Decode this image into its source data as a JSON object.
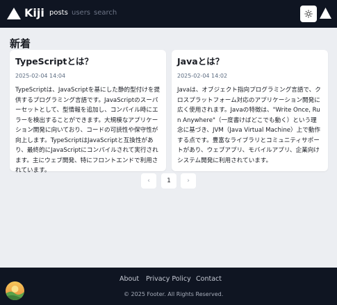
{
  "nav": {
    "brand": "Kiji",
    "links": [
      {
        "label": "posts"
      },
      {
        "label": "users"
      },
      {
        "label": "search"
      }
    ]
  },
  "main": {
    "section_title": "新着",
    "posts": [
      {
        "title": "TypeScriptとは？",
        "date": "2025-02-04 14:04",
        "body": "TypeScriptは、JavaScriptを基にした静的型付けを提供するプログラミング言語です。JavaScriptのスーパーセットとして、型情報を追加し、コンパイル時にエラーを検出することができます。大規模なアプリケーション開発に向いており、コードの可読性や保守性が向上します。TypeScriptはJavaScriptと互換性があり、最終的にJavaScriptにコンパイルされて実行されます。主にウェブ開発、特にフロントエンドで利用されています。"
      },
      {
        "title": "Javaとは？",
        "date": "2025-02-04 14:02",
        "body": "Javaは、オブジェクト指向プログラミング言語で、クロスプラットフォーム対応のアプリケーション開発に広く使用されます。Javaの特徴は、\"Write Once, Run Anywhere\"（一度書けばどこでも動く）という理念に基づき、JVM（Java Virtual Machine）上で動作する点です。豊富なライブラリとコミュニティサポートがあり、ウェブアプリ、モバイルアプリ、企業向けシステム開発に利用されています。"
      }
    ]
  },
  "pagination": {
    "prev": "‹",
    "current": "1",
    "next": "›"
  },
  "footer": {
    "links": [
      {
        "label": "About"
      },
      {
        "label": "Privacy Policy"
      },
      {
        "label": "Contact"
      }
    ],
    "copyright": "© 2025 Footer. All Rights Reserved."
  },
  "icons": {
    "logo": "triangle-logo-icon",
    "theme_toggle": "sun-icon",
    "right": "triangle-icon"
  },
  "colors": {
    "navbar_bg": "#0f1522",
    "page_bg": "#eceef2",
    "card_bg": "#ffffff",
    "date_text": "#5b6b80"
  }
}
